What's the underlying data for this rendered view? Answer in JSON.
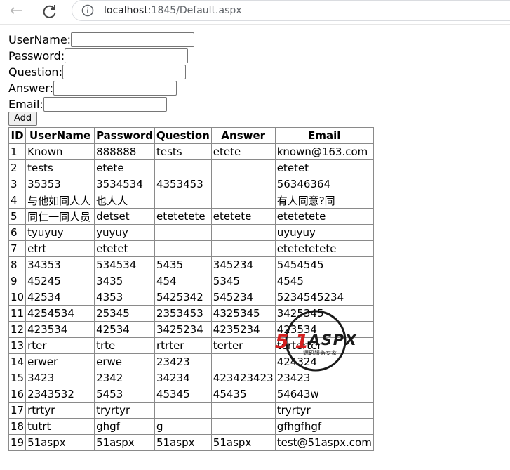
{
  "browser": {
    "url_host": "localhost",
    "url_rest": ":1845/Default.aspx"
  },
  "form": {
    "username_label": "UserName:",
    "password_label": "Password:",
    "question_label": "Question:",
    "answer_label": "Answer:",
    "email_label": "Email:",
    "username_value": "",
    "password_value": "",
    "question_value": "",
    "answer_value": "",
    "email_value": "",
    "add_label": "Add"
  },
  "table": {
    "headers": [
      "ID",
      "UserName",
      "Password",
      "Question",
      "Answer",
      "Email"
    ],
    "rows": [
      [
        "1",
        "Known",
        "888888",
        "tests",
        "etete",
        "known@163.com"
      ],
      [
        "2",
        "tests",
        "etete",
        "",
        "",
        "etetet"
      ],
      [
        "3",
        "35353",
        "3534534",
        "4353453",
        "",
        "56346364"
      ],
      [
        "4",
        "与他如同人人",
        "也人人",
        "",
        "",
        "有人同意?同"
      ],
      [
        "5",
        "同仁一同人员",
        "detset",
        "etetetete",
        "etetete",
        "etetetete"
      ],
      [
        "6",
        "tyuyuy",
        "yuyuy",
        "",
        "",
        "uyuyuy"
      ],
      [
        "7",
        "etrt",
        "etetet",
        "",
        "",
        "etetetetete"
      ],
      [
        "8",
        "34353",
        "534534",
        "5435",
        "345234",
        "5454545"
      ],
      [
        "9",
        "45245",
        "3435",
        "454",
        "5345",
        "4545"
      ],
      [
        "10",
        "42534",
        "4353",
        "5425342",
        "545234",
        "5234545234"
      ],
      [
        "11",
        "4254534",
        "25345",
        "2353453",
        "4325345",
        "3425345"
      ],
      [
        "12",
        "423534",
        "42534",
        "3425234",
        "4235234",
        "423534"
      ],
      [
        "13",
        "rter",
        "trte",
        "rtrter",
        "terter",
        "terterter"
      ],
      [
        "14",
        "erwer",
        "erwe",
        "23423",
        "",
        "424324"
      ],
      [
        "15",
        "3423",
        "2342",
        "34234",
        "423423423",
        "23423"
      ],
      [
        "16",
        "2343532",
        "5453",
        "45345",
        "45435",
        "54643w"
      ],
      [
        "17",
        "rtrtyr",
        "tryrtyr",
        "",
        "",
        "tryrtyr"
      ],
      [
        "18",
        "tutrt",
        "ghgf",
        "g",
        "",
        "gfhgfhgf"
      ],
      [
        "19",
        "51aspx",
        "51aspx",
        "51aspx",
        "51aspx",
        "test@51aspx.com"
      ]
    ]
  },
  "watermark": {
    "main_text": "51ASPX",
    "sub_text": "源码服务专家"
  }
}
